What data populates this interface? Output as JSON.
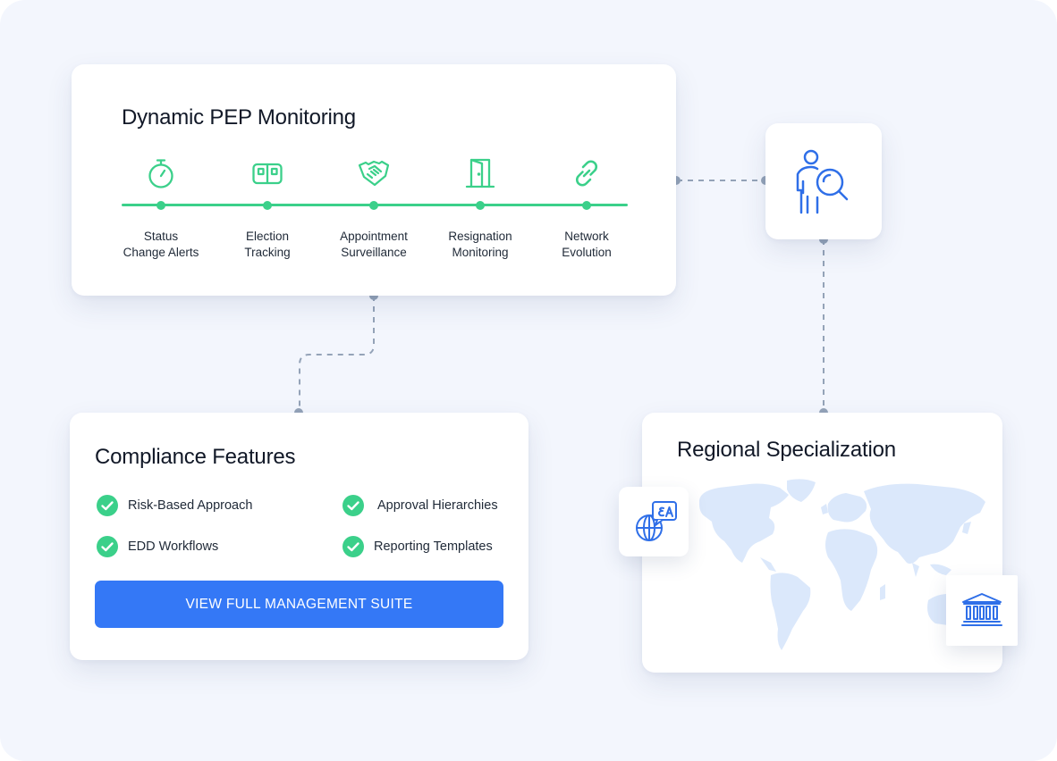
{
  "colors": {
    "background": "#f3f6fd",
    "timeline_green": "#3bd08a",
    "icon_blue": "#2f6fe8",
    "button_blue": "#3478f6",
    "map_fill": "#dbe8fb",
    "connector_gray": "#94a3b8"
  },
  "pep_monitoring": {
    "title": "Dynamic PEP Monitoring",
    "steps": [
      {
        "label": "Status\nChange Alerts",
        "icon": "stopwatch-icon"
      },
      {
        "label": "Election\nTracking",
        "icon": "ballot-box-icon"
      },
      {
        "label": "Appointment\nSurveillance",
        "icon": "handshake-icon"
      },
      {
        "label": "Resignation\nMonitoring",
        "icon": "exit-door-icon"
      },
      {
        "label": "Network\nEvolution",
        "icon": "chain-link-icon"
      }
    ]
  },
  "investigator": {
    "icon": "person-magnifier-icon"
  },
  "compliance": {
    "title": "Compliance Features",
    "features": [
      {
        "label": "Risk-Based Approach",
        "icon": "check-circle-icon"
      },
      {
        "label": "Approval Hierarchies",
        "icon": "check-circle-icon"
      },
      {
        "label": "EDD Workflows",
        "icon": "check-circle-icon"
      },
      {
        "label": "Reporting Templates",
        "icon": "check-circle-icon"
      }
    ],
    "cta_label": "VIEW FULL MANAGEMENT SUITE"
  },
  "regional": {
    "title": "Regional Specialization",
    "map": "world-map",
    "badges": [
      {
        "icon": "globe-translate-icon"
      },
      {
        "icon": "government-building-icon"
      }
    ]
  }
}
